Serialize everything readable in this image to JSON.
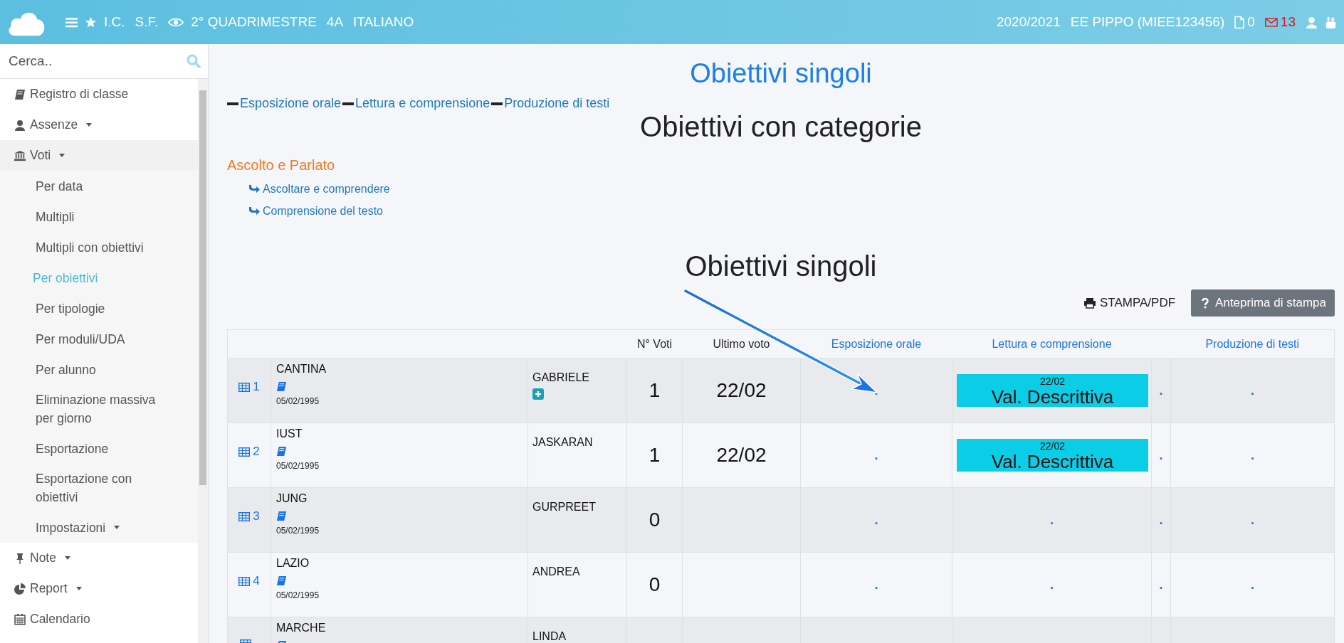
{
  "header": {
    "left": [
      "I.C.",
      "S.F."
    ],
    "period": "2° QUADRIMESTRE",
    "class": "4A",
    "subject": "ITALIANO",
    "year": "2020/2021",
    "user": "EE PIPPO (MIEE123456)",
    "documents": "0",
    "messages": "13"
  },
  "sidebar": {
    "search": {
      "placeholder": "Cerca.."
    },
    "items": [
      {
        "label": "Registro di classe",
        "has_submenu": false
      },
      {
        "label": "Assenze",
        "has_submenu": true,
        "expanded": false
      },
      {
        "label": "Voti",
        "has_submenu": true,
        "expanded": true,
        "children": [
          {
            "label": "Per data",
            "selected": false,
            "has_submenu": false
          },
          {
            "label": "Multipli",
            "selected": false,
            "has_submenu": false
          },
          {
            "label": "Multipli con obiettivi",
            "selected": false,
            "has_submenu": false
          },
          {
            "label": "Per obiettivi",
            "selected": true,
            "has_submenu": false
          },
          {
            "label": "Per tipologie",
            "selected": false,
            "has_submenu": false
          },
          {
            "label": "Per moduli/UDA",
            "selected": false,
            "has_submenu": false
          },
          {
            "label": "Per alunno",
            "selected": false,
            "has_submenu": false
          },
          {
            "label": "Eliminazione massiva per giorno",
            "selected": false,
            "has_submenu": false
          },
          {
            "label": "Esportazione",
            "selected": false,
            "has_submenu": false
          },
          {
            "label": "Esportazione con obiettivi",
            "selected": false,
            "has_submenu": false
          },
          {
            "label": "Impostazioni",
            "selected": false,
            "has_submenu": true
          }
        ]
      },
      {
        "label": "Note",
        "has_submenu": true,
        "expanded": false
      },
      {
        "label": "Report",
        "has_submenu": true,
        "expanded": false
      },
      {
        "label": "Calendario",
        "has_submenu": false
      }
    ]
  },
  "page": {
    "title": "Obiettivi singoli",
    "objective_links": [
      "Esposizione orale",
      "Lettura e comprensione",
      "Produzione di testi"
    ],
    "categories_heading": "Obiettivi con categorie",
    "category": {
      "title": "Ascolto e Parlato",
      "items": [
        "Ascoltare e comprendere",
        "Comprensione del testo"
      ]
    },
    "section_heading": "Obiettivi singoli",
    "buttons": [
      {
        "label": "STAMPA/PDF",
        "kind": "print"
      },
      {
        "label": "Anteprima di stampa",
        "kind": "preview"
      }
    ]
  },
  "table": {
    "columns": [
      "",
      "",
      "",
      "N° Voti",
      "Ultimo voto",
      "Esposizione orale",
      "Lettura e comprensione",
      "",
      "Produzione di testi"
    ],
    "rows": [
      {
        "index": "1",
        "surname": "CANTINA",
        "birth_date": "05/02/1995",
        "first_name": "GABRIELE",
        "add_badge": true,
        "count": "1",
        "last_grade": "22/02",
        "cells": [
          {
            "kind": "dot",
            "text": "."
          },
          {
            "kind": "grade",
            "date": "22/02",
            "text": "Val. Descrittiva"
          },
          {
            "kind": "dot",
            "text": "."
          },
          {
            "kind": "dot",
            "text": "."
          }
        ]
      },
      {
        "index": "2",
        "surname": "IUST",
        "birth_date": "05/02/1995",
        "first_name": "JASKARAN",
        "add_badge": false,
        "count": "1",
        "last_grade": "22/02",
        "cells": [
          {
            "kind": "dot",
            "text": "."
          },
          {
            "kind": "grade",
            "date": "22/02",
            "text": "Val. Descrittiva"
          },
          {
            "kind": "dot",
            "text": "."
          },
          {
            "kind": "dot",
            "text": "."
          }
        ]
      },
      {
        "index": "3",
        "surname": "JUNG",
        "birth_date": "05/02/1995",
        "first_name": "GURPREET",
        "add_badge": false,
        "count": "0",
        "cells": [
          {
            "kind": "dot",
            "text": "."
          },
          {
            "kind": "dot",
            "text": "."
          },
          {
            "kind": "dot",
            "text": "."
          },
          {
            "kind": "dot",
            "text": "."
          }
        ]
      },
      {
        "index": "4",
        "surname": "LAZIO",
        "birth_date": "05/02/1995",
        "first_name": "ANDREA",
        "add_badge": false,
        "count": "0",
        "cells": [
          {
            "kind": "dot",
            "text": "."
          },
          {
            "kind": "dot",
            "text": "."
          },
          {
            "kind": "dot",
            "text": "."
          },
          {
            "kind": "dot",
            "text": "."
          }
        ]
      },
      {
        "surname": "MARCHE",
        "first_name": "LINDA",
        "add_badge": false,
        "cells": []
      }
    ]
  }
}
